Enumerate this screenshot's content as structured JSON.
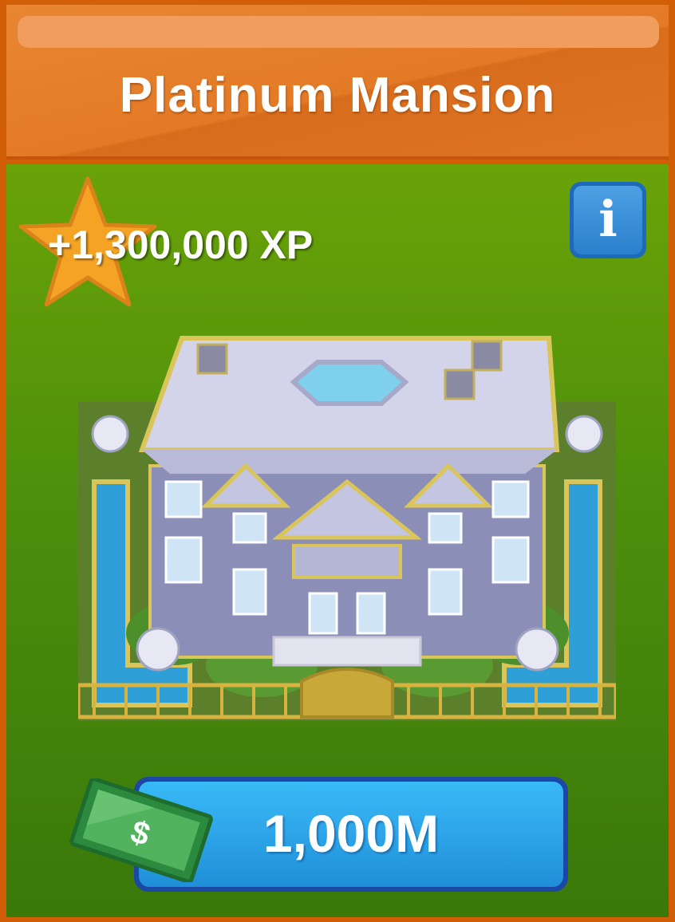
{
  "header": {
    "title": "Platinum Mansion"
  },
  "reward": {
    "xp_text": "+1,300,000 XP",
    "icon": "star-icon"
  },
  "info_button": {
    "label": "i",
    "icon": "info-icon"
  },
  "building": {
    "image": "platinum-mansion-illustration"
  },
  "buy_button": {
    "price": "1,000M",
    "currency_icon": "cash-bill-icon",
    "currency_symbol": "$"
  },
  "colors": {
    "header_orange": "#e37a26",
    "body_green": "#4d8f0c",
    "button_blue": "#2fa7ea",
    "info_blue": "#2b80cc",
    "star_gold": "#f4a324"
  }
}
